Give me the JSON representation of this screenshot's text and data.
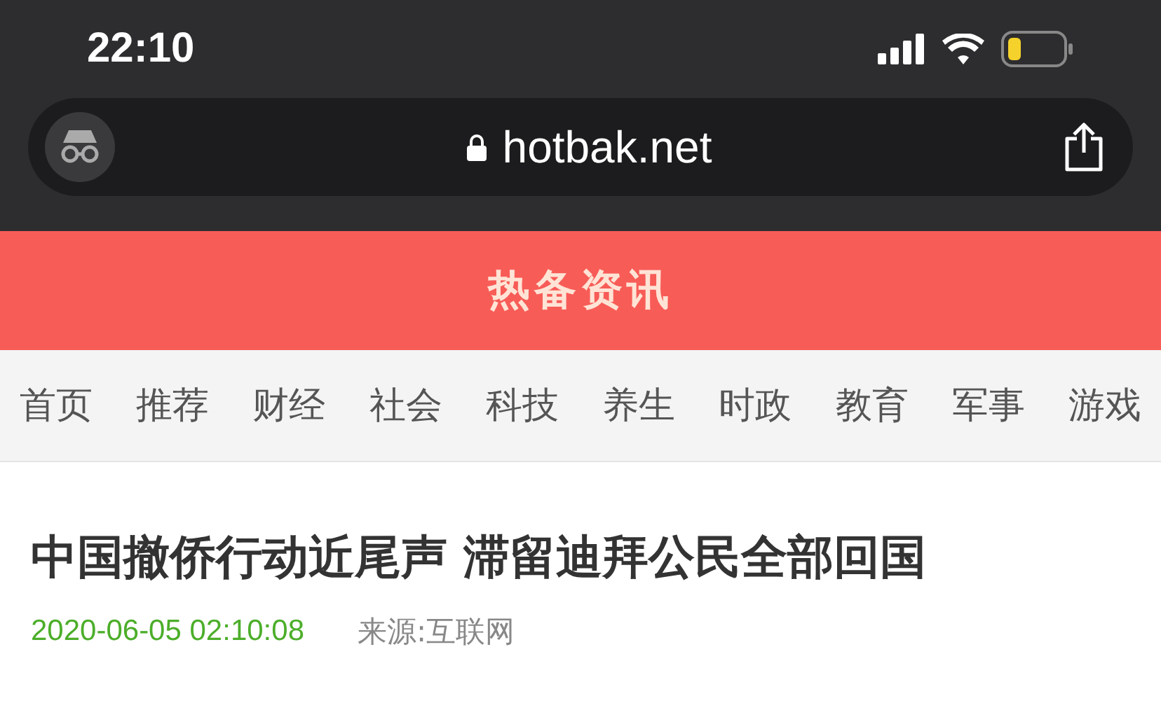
{
  "status_bar": {
    "time": "22:10"
  },
  "browser_bar": {
    "url": "hotbak.net"
  },
  "site_header": {
    "title": "热备资讯"
  },
  "nav": [
    {
      "label": "首页"
    },
    {
      "label": "推荐"
    },
    {
      "label": "财经"
    },
    {
      "label": "社会"
    },
    {
      "label": "科技"
    },
    {
      "label": "养生"
    },
    {
      "label": "时政"
    },
    {
      "label": "教育"
    },
    {
      "label": "军事"
    },
    {
      "label": "游戏"
    }
  ],
  "article": {
    "title": "中国撤侨行动近尾声 滞留迪拜公民全部回国",
    "date": "2020-06-05 02:10:08",
    "source": "来源:互联网"
  }
}
